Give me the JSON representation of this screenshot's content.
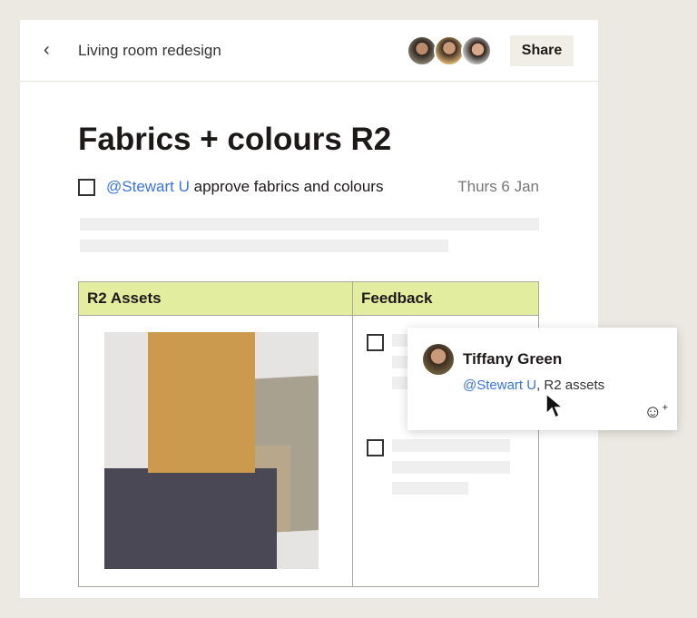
{
  "header": {
    "title": "Living room redesign",
    "share_label": "Share",
    "back_icon": "chevron-left-icon",
    "avatars": [
      "avatar-1",
      "avatar-2",
      "avatar-3"
    ]
  },
  "doc": {
    "title": "Fabrics + colours R2",
    "task": {
      "mention": "@Stewart U",
      "text": " approve fabrics and colours",
      "date": "Thurs 6 Jan"
    }
  },
  "table": {
    "headers": [
      "R2 Assets",
      "Feedback"
    ]
  },
  "comment": {
    "author": "Tiffany Green",
    "mention": "@Stewart U",
    "text": ", R2 assets",
    "reaction_icon": "add-emoji-icon"
  }
}
